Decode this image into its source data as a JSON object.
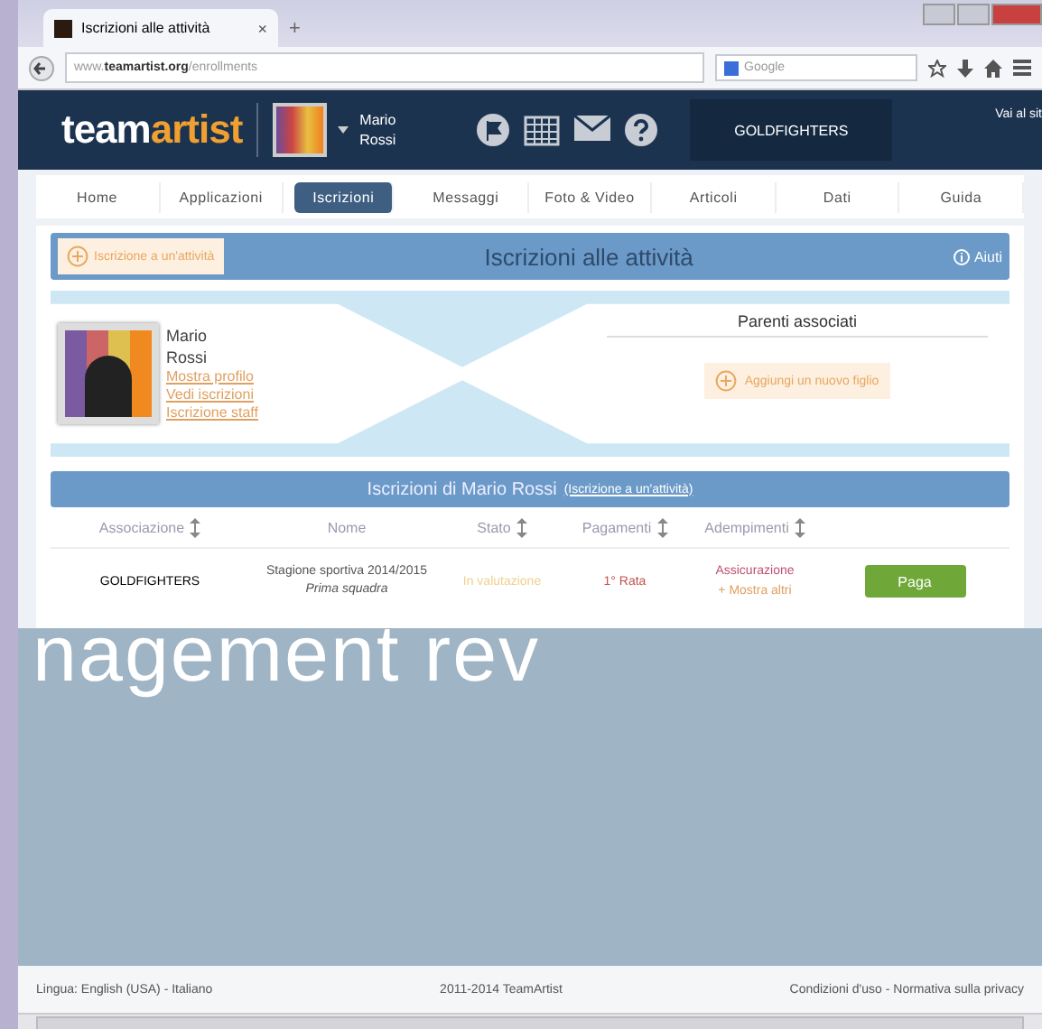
{
  "browser": {
    "tab_title": "Iscrizioni alle attività",
    "new_tab": "+",
    "close": "×",
    "url_prefix": "www.",
    "url_domain": "teamartist.org",
    "url_path": "/enrollments",
    "search_placeholder": "Google"
  },
  "header": {
    "logo_team": "team",
    "logo_artist": "artist",
    "user_first": "Mario",
    "user_last": "Rossi",
    "team_name": "GOLDFIGHTERS",
    "site_link": "Vai al sit"
  },
  "tabs": [
    {
      "label": "Home",
      "selected": false
    },
    {
      "label": "Applicazioni",
      "selected": false
    },
    {
      "label": "Iscrizioni",
      "selected": true
    },
    {
      "label": "Messaggi",
      "selected": false
    },
    {
      "label": "Foto & Video",
      "selected": false
    },
    {
      "label": "Articoli",
      "selected": false
    },
    {
      "label": "Dati",
      "selected": false
    },
    {
      "label": "Guida",
      "selected": false
    }
  ],
  "title_bar": {
    "enroll_button": "Iscrizione a un'attività",
    "title": "Iscrizioni alle attività",
    "help": "Aiuti"
  },
  "profile": {
    "first_name": "Mario",
    "last_name": "Rossi",
    "links": [
      "Mostra profilo",
      "Vedi iscrizioni",
      "Iscrizione staff"
    ]
  },
  "relatives": {
    "title": "Parenti associati",
    "add_button": "Aggiungi un nuovo figlio"
  },
  "enrollments": {
    "title": "Iscrizioni di Mario Rossi",
    "title_link": "(Iscrizione a un'attività)",
    "columns": [
      {
        "label": "Associazione",
        "sortable": true
      },
      {
        "label": "Nome",
        "sortable": false
      },
      {
        "label": "Stato",
        "sortable": true
      },
      {
        "label": "Pagamenti",
        "sortable": true
      },
      {
        "label": "Adempimenti",
        "sortable": true
      }
    ],
    "rows": [
      {
        "association": "GOLDFIGHTERS",
        "season": "Stagione sportiva 2014/2015",
        "team": "Prima squadra",
        "status": "In valutazione",
        "payment": "1° Rata",
        "requirement": "Assicurazione",
        "more": "+ Mostra altri",
        "action": "Paga"
      }
    ]
  },
  "background_slogan": "nagement rev",
  "footer": {
    "language": "Lingua: English (USA) - Italiano",
    "copyright": "2011-2014 TeamArtist",
    "legal": "Condizioni d'uso - Normativa sulla privacy"
  }
}
